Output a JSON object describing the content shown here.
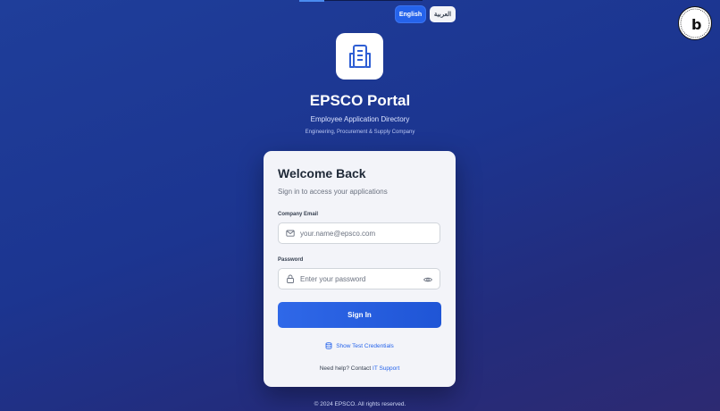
{
  "language": {
    "english_label": "English",
    "arabic_label": "العربية"
  },
  "header": {
    "title": "EPSCO Portal",
    "subtitle": "Employee Application Directory",
    "tagline": "Engineering, Procurement & Supply Company"
  },
  "login": {
    "heading": "Welcome Back",
    "subheading": "Sign in to access your applications",
    "email_label": "Company Email",
    "email_placeholder": "your.name@epsco.com",
    "password_label": "Password",
    "password_placeholder": "Enter your password",
    "signin_label": "Sign In",
    "credentials_link": "Show Test Credentials",
    "help_text": "Need help? Contact",
    "support_link": "IT Support"
  },
  "footer": {
    "copyright": "© 2024 EPSCO. All rights reserved."
  },
  "colors": {
    "accent": "#2563eb",
    "background": "#1f3e9a"
  },
  "icons": [
    "building-icon",
    "mail-icon",
    "lock-icon",
    "eye-icon",
    "database-icon",
    "bolt-badge-icon"
  ]
}
